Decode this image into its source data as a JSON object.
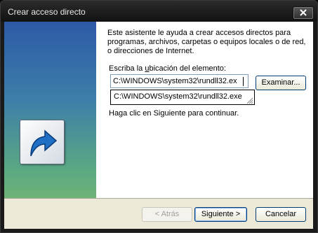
{
  "window": {
    "title": "Crear acceso directo",
    "close_label": "Cerrar"
  },
  "wizard": {
    "description": "Este asistente le ayuda a crear accesos directos para programas, archivos, carpetas o equipos locales o de red, o direcciones de Internet.",
    "location_label_pre": "Escriba la ",
    "location_label_accel": "u",
    "location_label_post": "bicación del elemento:",
    "location_value": "C:\\WINDOWS\\system32\\rundll32.ex",
    "browse_label": "Examinar...",
    "autocomplete_item": "C:\\WINDOWS\\system32\\rundll32.exe",
    "hint": "Haga clic en Siguiente para continuar.",
    "icon": "shortcut-arrow-icon"
  },
  "footer": {
    "back_label": "< Atrás",
    "next_label": "Siguiente >",
    "cancel_label": "Cancelar"
  },
  "colors": {
    "side_panel_top": "#2d5aa6",
    "side_panel_bottom": "#6fb276",
    "shortcut_arrow": "#1f6fc4"
  }
}
